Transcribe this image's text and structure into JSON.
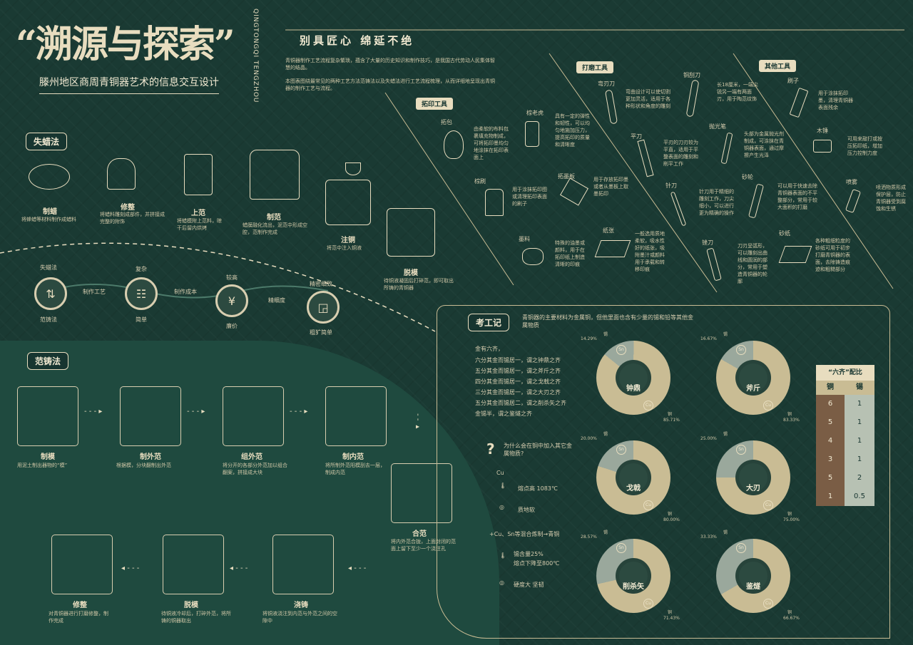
{
  "title": {
    "main": "“溯源与探索”",
    "sub": "滕州地区商周青铜器艺术的信息交互设计",
    "pinyin": "QINGTONGQI TENGZHOU"
  },
  "craft": {
    "title": "别具匠心  绵延不绝",
    "intro1": "青铜器制作工艺流程复杂繁琐，蕴含了大量的历史知识和制作技巧，是我国古代劳动人民集体智慧的结晶。",
    "intro2": "本图表图绕最常见的两种工艺方法范铸法以及失蜡法进行工艺流程梳理，从而详细地呈现出青铜器的制作工艺与流程。"
  },
  "tools": {
    "rubbing_label": "拓印工具",
    "polish_label": "打磨工具",
    "other_label": "其他工具",
    "rubbing": [
      {
        "name": "拓包",
        "desc": "由柔软的布料包裹填充物制成，可将拓印墨均匀地涂抹在拓印表面上"
      },
      {
        "name": "棕老虎",
        "desc": "具有一定的弹性和韧性，可以均匀地施加压力，提高拓印的质量和清晰度"
      },
      {
        "name": "棕刷",
        "desc": "用于涂抹拓印图或清理拓印表面的刷子"
      },
      {
        "name": "拓墨板",
        "desc": "用于存放拓印墨或者从墨板上取墨拓印"
      },
      {
        "name": "墨料",
        "desc": "特殊的油墨或颜料，用于在拓印纸上制造清晰的印痕"
      },
      {
        "name": "纸张",
        "desc": "一般选用质地柔软，吸水性好的纸张，吸附墨汁或颜料用于承载和转移印痕"
      }
    ],
    "polish": [
      {
        "name": "弯刃刀",
        "desc": "弯曲设计可以使切割更加灵活，适用于各种形状和角度的雕刻"
      },
      {
        "name": "铜刮刀",
        "desc": "长18厘米，一端尖锐另一端有两面刃，用于陶范纹饰"
      },
      {
        "name": "平刀",
        "desc": "平刃的刀刃较为平直，适用于平整表面的雕刻和削平工作"
      },
      {
        "name": "抛光笔",
        "desc": "头部为金属抛光剂制成，可涂抹在青铜器表面，通过摩擦产生光泽"
      },
      {
        "name": "针刀",
        "desc": "针刀用于精细的雕刻工作，刀尖细小，可以进行更为精确的操作"
      },
      {
        "name": "砂轮",
        "desc": "可以用于快速去除青铜器表面的不平整部分，常用于较大面积的打磨"
      },
      {
        "name": "锉刀",
        "desc": "刀刃呈弧形，可以雕刻出曲线和圆润的部分，常用于塑造青铜器的轮廓"
      },
      {
        "name": "砂纸",
        "desc": "各种粗细粒度的砂纸可用于初步打磨青铜器的表面，去除铸造痕迹和粗糙部分"
      }
    ],
    "other": [
      {
        "name": "刷子",
        "desc": "用于涂抹拓印墨，清理青铜器表面残余"
      },
      {
        "name": "木锤",
        "desc": "可用来敲打或按压拓印纸，增加压力控制力度"
      },
      {
        "name": "喷雾",
        "desc": "喷洒物质形成保护层，防止青铜器受到腐蚀和生锈"
      }
    ]
  },
  "lostwax": {
    "badge": "失蜡法",
    "steps": [
      {
        "name": "制蜡",
        "desc": "将蜂蜡等材料制作成蜡料"
      },
      {
        "name": "修整",
        "desc": "将蜡料雕刻成部件，并拼接成完整的附饰"
      },
      {
        "name": "上范",
        "desc": "将蜡模附上范料，晾干后留内烘烤"
      },
      {
        "name": "制范",
        "desc": "蜡膜融化流出，泥范中形成空腔，范制作完成"
      },
      {
        "name": "注铜",
        "desc": "将范中注入铜液"
      },
      {
        "name": "脱模",
        "desc": "待铜液凝固后打碎范，即可取出所铸的青铜器"
      }
    ]
  },
  "compare": {
    "left_top": "失蜡法",
    "left_bottom": "范铸法",
    "items": [
      {
        "top": "",
        "mid": "制作工艺",
        "bottom": ""
      },
      {
        "top": "复杂",
        "mid": "制作成本",
        "bottom": "简单"
      },
      {
        "top": "较高",
        "mid": "精细度",
        "bottom": "廉价"
      },
      {
        "top": "精密细致",
        "mid": "",
        "bottom": "粗犷简单"
      }
    ]
  },
  "piece": {
    "badge": "范铸法",
    "steps": [
      {
        "name": "制模",
        "desc": "用泥土制出器物的“模”"
      },
      {
        "name": "制外范",
        "desc": "根据模，分块翻制出外范"
      },
      {
        "name": "组外范",
        "desc": "将分开的各部分外范加以组合翻案，拼接成大块"
      },
      {
        "name": "制内范",
        "desc": "将所制外范阳模刮去一层，制成内范"
      },
      {
        "name": "合范",
        "desc": "将内外范合拢，上面封闭的范面上留下至少一个浇注孔"
      },
      {
        "name": "浇铸",
        "desc": "将铜液浇注到内范与外范之间的空隙中"
      },
      {
        "name": "脱模",
        "desc": "待铜液冷却后，打碎外范，将所铸的铜器取出"
      },
      {
        "name": "修整",
        "desc": "对青铜器进行打磨修整，制作完成"
      }
    ]
  },
  "kaogongji": {
    "badge": "考工记",
    "intro": "青铜器的主要材料为金属铜，但他里面也含有少量的锡和铅等其他金属物质",
    "verses": [
      "金有六齐，",
      "六分其金而锡居一，谓之钟鼎之齐",
      "五分其金而锡居一，谓之斧斤之齐",
      "四分其金而锡居一，谓之戈戟之齐",
      "三分其金而锡居一，谓之大刃之齐",
      "五分其金而锡居二，谓之削杀矢之齐",
      "金锡半，谓之鉴燧之齐"
    ],
    "question": "为什么会在铜中加入其它金属物质?",
    "cu": "Cu",
    "melt": "熔点高 1083℃",
    "soft": "质地软",
    "mix": "+Cu、Sn等混合炼制→青铜",
    "tin": "锡含量25%",
    "drop": "熔点下降至800℃",
    "hard": "硬度大 坚韧",
    "rings": [
      {
        "name": "钟鼎",
        "tin": "14.29%",
        "cu": "85.71%",
        "sn_frac": 0.1429
      },
      {
        "name": "斧斤",
        "tin": "16.67%",
        "cu": "83.33%",
        "sn_frac": 0.1667
      },
      {
        "name": "戈戟",
        "tin": "20.00%",
        "cu": "80.00%",
        "sn_frac": 0.2
      },
      {
        "name": "大刃",
        "tin": "25.00%",
        "cu": "75.00%",
        "sn_frac": 0.25
      },
      {
        "name": "削杀矢",
        "tin": "28.57%",
        "cu": "71.43%",
        "sn_frac": 0.2857
      },
      {
        "name": "鉴燧",
        "tin": "33.33%",
        "cu": "66.67%",
        "sn_frac": 0.3333
      }
    ],
    "lbl_tin": "锡",
    "lbl_cu": "铜",
    "lbl_sn": "Sn",
    "lbl_cu2": "Cu",
    "table": {
      "title": "“六齐”配比",
      "h1": "铜",
      "h2": "锡",
      "rows": [
        [
          "6",
          "1"
        ],
        [
          "5",
          "1"
        ],
        [
          "4",
          "1"
        ],
        [
          "3",
          "1"
        ],
        [
          "5",
          "2"
        ],
        [
          "1",
          "0.5"
        ]
      ]
    }
  },
  "colors": {
    "bg": "#1a3a33",
    "cream": "#e8ddbf",
    "tan": "#c9bc94",
    "grey": "#9aa89c",
    "brown": "#7a5d45"
  }
}
